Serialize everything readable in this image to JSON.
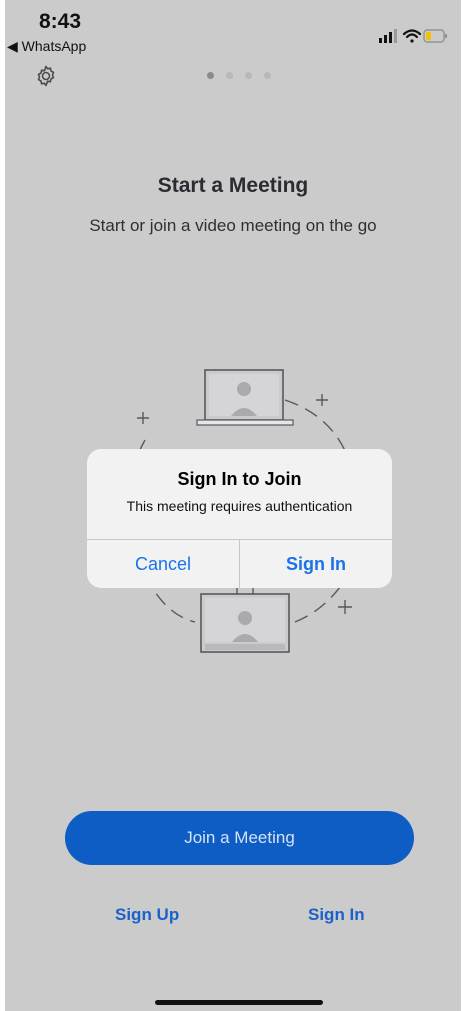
{
  "status_bar": {
    "time": "8:43",
    "back_app": "◀ WhatsApp"
  },
  "page": {
    "title": "Start a Meeting",
    "subtitle": "Start or join a video meeting on the go",
    "pagination": {
      "total": 4,
      "active": 1
    }
  },
  "alert": {
    "title": "Sign In to Join",
    "message": "This meeting requires authentication",
    "cancel_label": "Cancel",
    "signin_label": "Sign In"
  },
  "actions": {
    "join_label": "Join a Meeting",
    "signup_label": "Sign Up",
    "signin_label": "Sign In"
  },
  "colors": {
    "background": "#cbcbcb",
    "accent": "#0e5dc4",
    "link": "#1a62c8",
    "alert_button": "#1a73e8"
  },
  "icons": [
    "settings-gear-icon",
    "signal-icon",
    "wifi-icon",
    "battery-icon"
  ]
}
